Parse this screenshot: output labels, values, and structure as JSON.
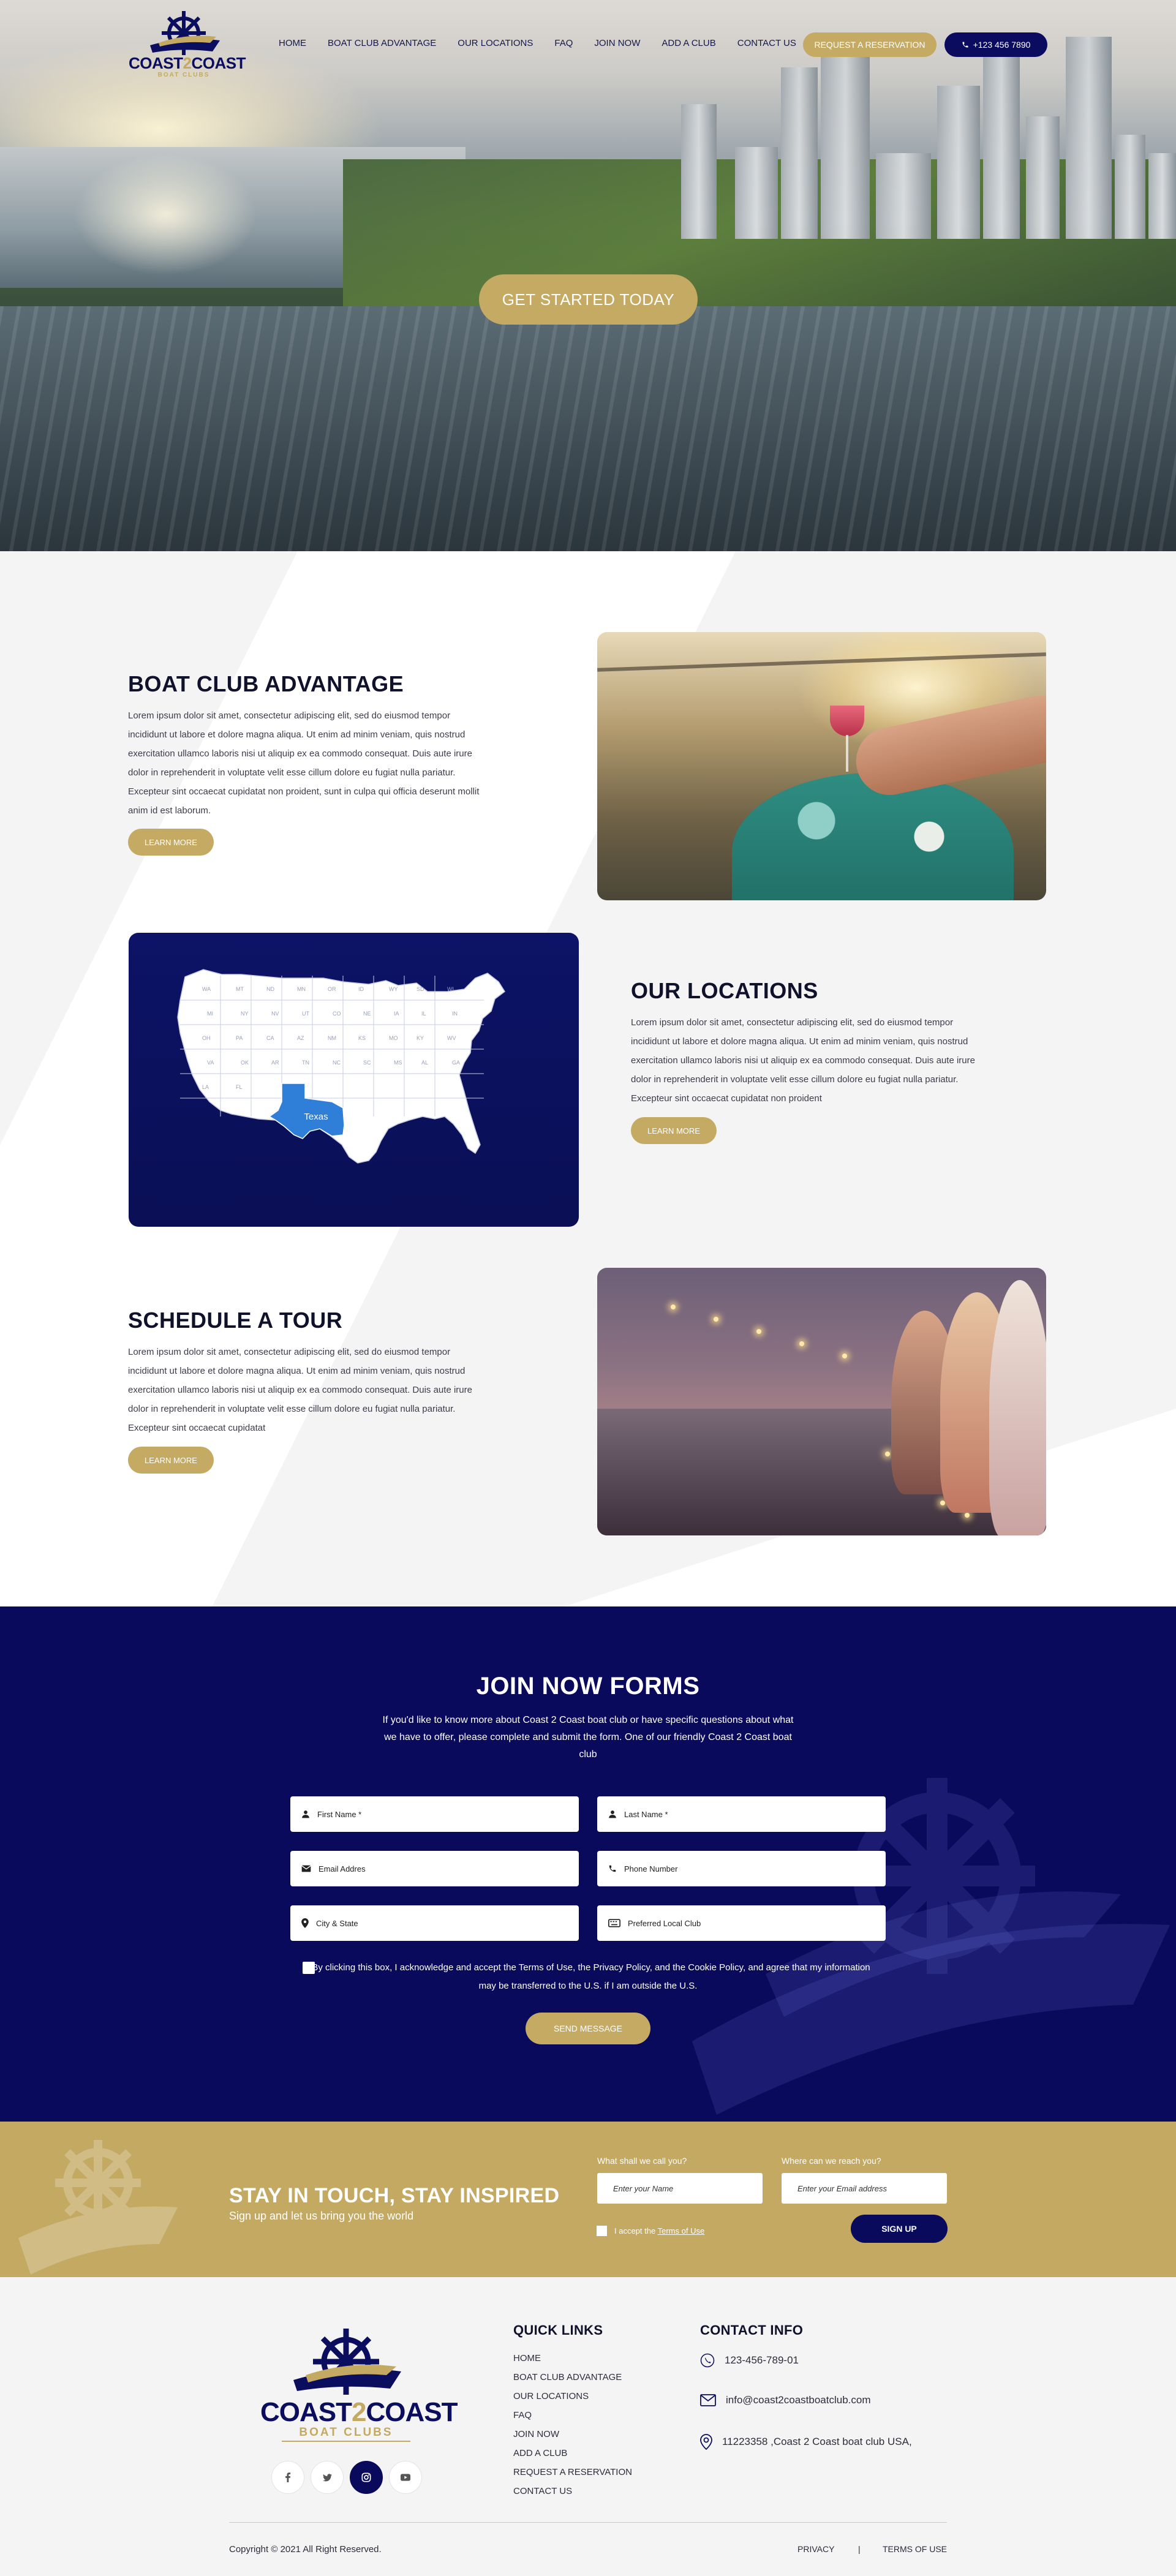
{
  "brand": {
    "name_part1": "COAST",
    "name_part2": "2",
    "name_part3": "COAST",
    "tagline": "BOAT CLUBS",
    "navy": "#0b0c5f",
    "gold": "#c4aa63"
  },
  "nav": {
    "items": [
      "HOME",
      "BOAT CLUB ADVANTAGE",
      "OUR LOCATIONS",
      "FAQ",
      "JOIN NOW",
      "ADD A CLUB",
      "CONTACT US"
    ],
    "reserve_label": "REQUEST A RESERVATION",
    "phone_label": "+123 456 7890",
    "phone_icon": "phone-icon"
  },
  "hero": {
    "cta_label": "GET STARTED TODAY"
  },
  "features": [
    {
      "title": "BOAT CLUB ADVANTAGE",
      "text": "Lorem ipsum dolor sit amet, consectetur adipiscing elit, sed do eiusmod tempor incididunt ut labore et dolore magna aliqua. Ut enim ad minim veniam, quis nostrud exercitation ullamco laboris nisi ut aliquip ex ea commodo consequat. Duis aute irure dolor in reprehenderit in voluptate velit esse cillum dolore eu fugiat nulla pariatur. Excepteur sint occaecat cupidatat non proident, sunt in culpa qui officia deserunt mollit anim id est laborum.",
      "button": "LEARN MORE"
    },
    {
      "title": "OUR LOCATIONS",
      "text": "Lorem ipsum dolor sit amet, consectetur adipiscing elit, sed do eiusmod tempor incididunt ut labore et dolore magna aliqua. Ut enim ad minim veniam, quis nostrud exercitation ullamco laboris nisi ut aliquip ex ea commodo consequat. Duis aute irure dolor in reprehenderit in voluptate velit esse cillum dolore eu fugiat nulla pariatur. Excepteur sint occaecat cupidatat non proident",
      "button": "LEARN MORE"
    },
    {
      "title": "SCHEDULE A TOUR",
      "text": "Lorem ipsum dolor sit amet, consectetur adipiscing elit, sed do eiusmod tempor incididunt ut labore et dolore magna aliqua. Ut enim ad minim veniam, quis nostrud exercitation ullamco laboris nisi ut aliquip ex ea commodo consequat. Duis aute irure dolor in reprehenderit in voluptate velit esse cillum dolore eu fugiat nulla pariatur. Excepteur sint occaecat cupidatat",
      "button": "LEARN MORE"
    }
  ],
  "map": {
    "highlight_label": "Texas",
    "highlight_color": "#2f7ed8",
    "state_labels": [
      "WA",
      "MT",
      "ND",
      "MN",
      "OR",
      "ID",
      "WY",
      "SD",
      "WI",
      "MI",
      "NY",
      "NV",
      "UT",
      "CO",
      "NE",
      "IA",
      "IL",
      "IN",
      "OH",
      "PA",
      "CA",
      "AZ",
      "NM",
      "KS",
      "MO",
      "KY",
      "WV",
      "VA",
      "OK",
      "AR",
      "TN",
      "NC",
      "SC",
      "MS",
      "AL",
      "GA",
      "LA",
      "FL"
    ]
  },
  "join": {
    "title": "JOIN NOW FORMS",
    "description": "If you'd like to know more about Coast 2 Coast boat club  or have specific questions about what we have to offer, please complete and submit the form. One of our friendly Coast 2 Coast boat club",
    "fields": {
      "first_name": "First Name *",
      "last_name": "Last Name *",
      "email": "Email Addres",
      "phone": "Phone Number",
      "city": "City & State",
      "club": "Preferred Local Club"
    },
    "consent": "* By clicking this box, I acknowledge and accept the Terms of Use, the Privacy Policy, and the Cookie Policy, and agree that my information may be transferred to the U.S. if I am outside the U.S.",
    "submit_label": "SEND MESSAGE"
  },
  "newsletter": {
    "title": "STAY IN TOUCH, STAY INSPIRED",
    "subtitle": "Sign up and let us bring you the world",
    "name_label": "What shall we call you?",
    "name_placeholder": "Enter your Name",
    "email_label": "Where can we reach you?",
    "email_placeholder": "Enter your Email address",
    "accept_text": "I accept the",
    "accept_link": "Terms of Use",
    "signup_label": "SIGN UP"
  },
  "footer": {
    "quick_links_title": "QUICK LINKS",
    "quick_links": [
      "HOME",
      "BOAT CLUB ADVANTAGE",
      "OUR LOCATIONS",
      "FAQ",
      "JOIN NOW",
      "ADD A CLUB",
      "REQUEST A RESERVATION",
      "CONTACT US"
    ],
    "contact_title": "CONTACT INFO",
    "phone": "123-456-789-01",
    "email": "info@coast2coastboatclub.com",
    "address": "11223358 ,Coast 2 Coast boat club USA,",
    "social": [
      "facebook-icon",
      "twitter-icon",
      "instagram-icon",
      "youtube-icon"
    ],
    "copyright": "Copyright © 2021 All Right Reserved.",
    "privacy": "PRIVACY",
    "separator": "|",
    "terms": "TERMS OF USE"
  }
}
